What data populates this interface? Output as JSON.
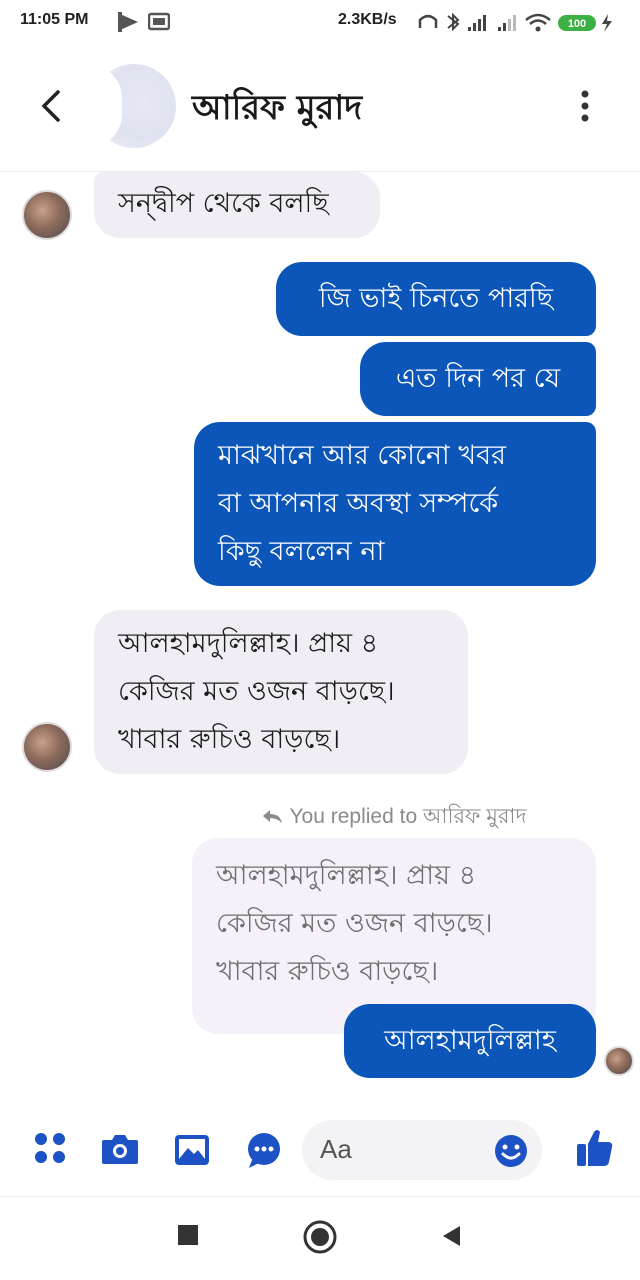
{
  "status_bar": {
    "time": "11:05 PM",
    "net_speed": "2.3KB/s",
    "battery": "100"
  },
  "header": {
    "contact_name": "আরিফ মুরাদ"
  },
  "messages": [
    {
      "dir": "in",
      "text": "সন্দ্বীপ থেকে বলছি"
    },
    {
      "dir": "out",
      "text": "জি ভাই চিনতে পারছি"
    },
    {
      "dir": "out",
      "text": "এত দিন পর যে"
    },
    {
      "dir": "out",
      "lines": [
        "মাঝখানে আর কোনো খবর",
        "বা আপনার অবস্থা সম্পর্কে",
        "কিছু বললেন না"
      ]
    },
    {
      "dir": "in",
      "lines": [
        "আলহামদুলিল্লাহ। প্রায় ৪",
        "কেজির মত ওজন বাড়ছে।",
        "খাবার রুচিও বাড়ছে।"
      ]
    }
  ],
  "reply": {
    "note_prefix": "You replied to",
    "note_name": "আরিফ মুরাদ",
    "quoted_lines": [
      "আলহামদুলিল্লাহ। প্রায় ৪",
      "কেজির মত ওজন বাড়ছে।",
      "খাবার রুচিও বাড়ছে।"
    ],
    "text": "আলহামদুলিল্লাহ"
  },
  "composer": {
    "placeholder": "Aa"
  },
  "colors": {
    "accent": "#0b56b8",
    "incoming_bubble": "#f1edf5"
  }
}
